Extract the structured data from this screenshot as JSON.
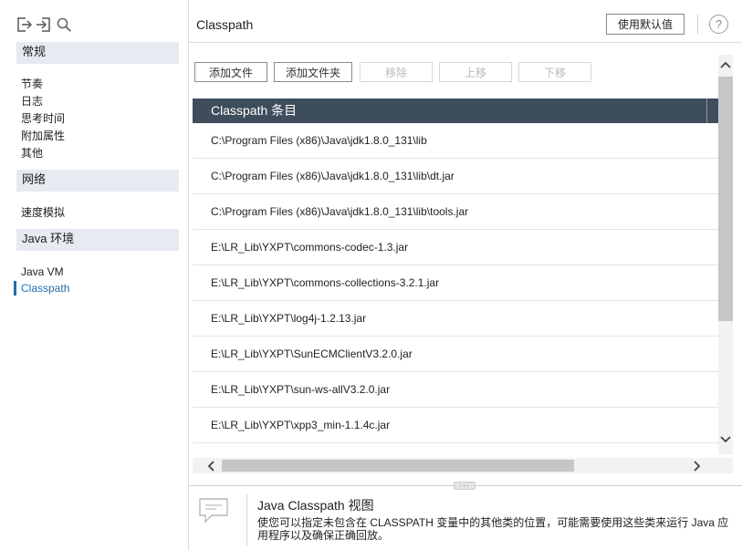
{
  "sidebar": {
    "toolbar_icons": [
      "export-icon",
      "import-icon",
      "search-icon"
    ],
    "sections": [
      {
        "header": "常规",
        "items": [
          {
            "label": "节奏"
          },
          {
            "label": "日志"
          },
          {
            "label": "思考时间"
          },
          {
            "label": "附加属性"
          },
          {
            "label": "其他"
          }
        ]
      },
      {
        "header": "网络",
        "items": [
          {
            "label": "速度模拟"
          }
        ]
      },
      {
        "header": "Java 环境",
        "items": [
          {
            "label": "Java VM"
          },
          {
            "label": "Classpath",
            "active": true
          }
        ]
      }
    ]
  },
  "header": {
    "title": "Classpath",
    "defaults_label": "使用默认值",
    "help_glyph": "?"
  },
  "toolbar": {
    "add_file": "添加文件",
    "add_folder": "添加文件夹",
    "remove": "移除",
    "move_up": "上移",
    "move_down": "下移"
  },
  "table": {
    "header": "Classpath 条目",
    "rows": [
      "C:\\Program Files (x86)\\Java\\jdk1.8.0_131\\lib",
      "C:\\Program Files (x86)\\Java\\jdk1.8.0_131\\lib\\dt.jar",
      "C:\\Program Files (x86)\\Java\\jdk1.8.0_131\\lib\\tools.jar",
      "E:\\LR_Lib\\YXPT\\commons-codec-1.3.jar",
      "E:\\LR_Lib\\YXPT\\commons-collections-3.2.1.jar",
      "E:\\LR_Lib\\YXPT\\log4j-1.2.13.jar",
      "E:\\LR_Lib\\YXPT\\SunECMClientV3.2.0.jar",
      "E:\\LR_Lib\\YXPT\\sun-ws-allV3.2.0.jar",
      "E:\\LR_Lib\\YXPT\\xpp3_min-1.1.4c.jar"
    ]
  },
  "info": {
    "title": "Java Classpath 视图",
    "description": "使您可以指定未包含在 CLASSPATH 变量中的其他类的位置，可能需要使用这些类来运行 Java 应用程序以及确保正确回放。"
  },
  "colors": {
    "table_header": "#3e4d5c",
    "accent": "#1b6fb5",
    "section_header": "#e6ebf1"
  }
}
